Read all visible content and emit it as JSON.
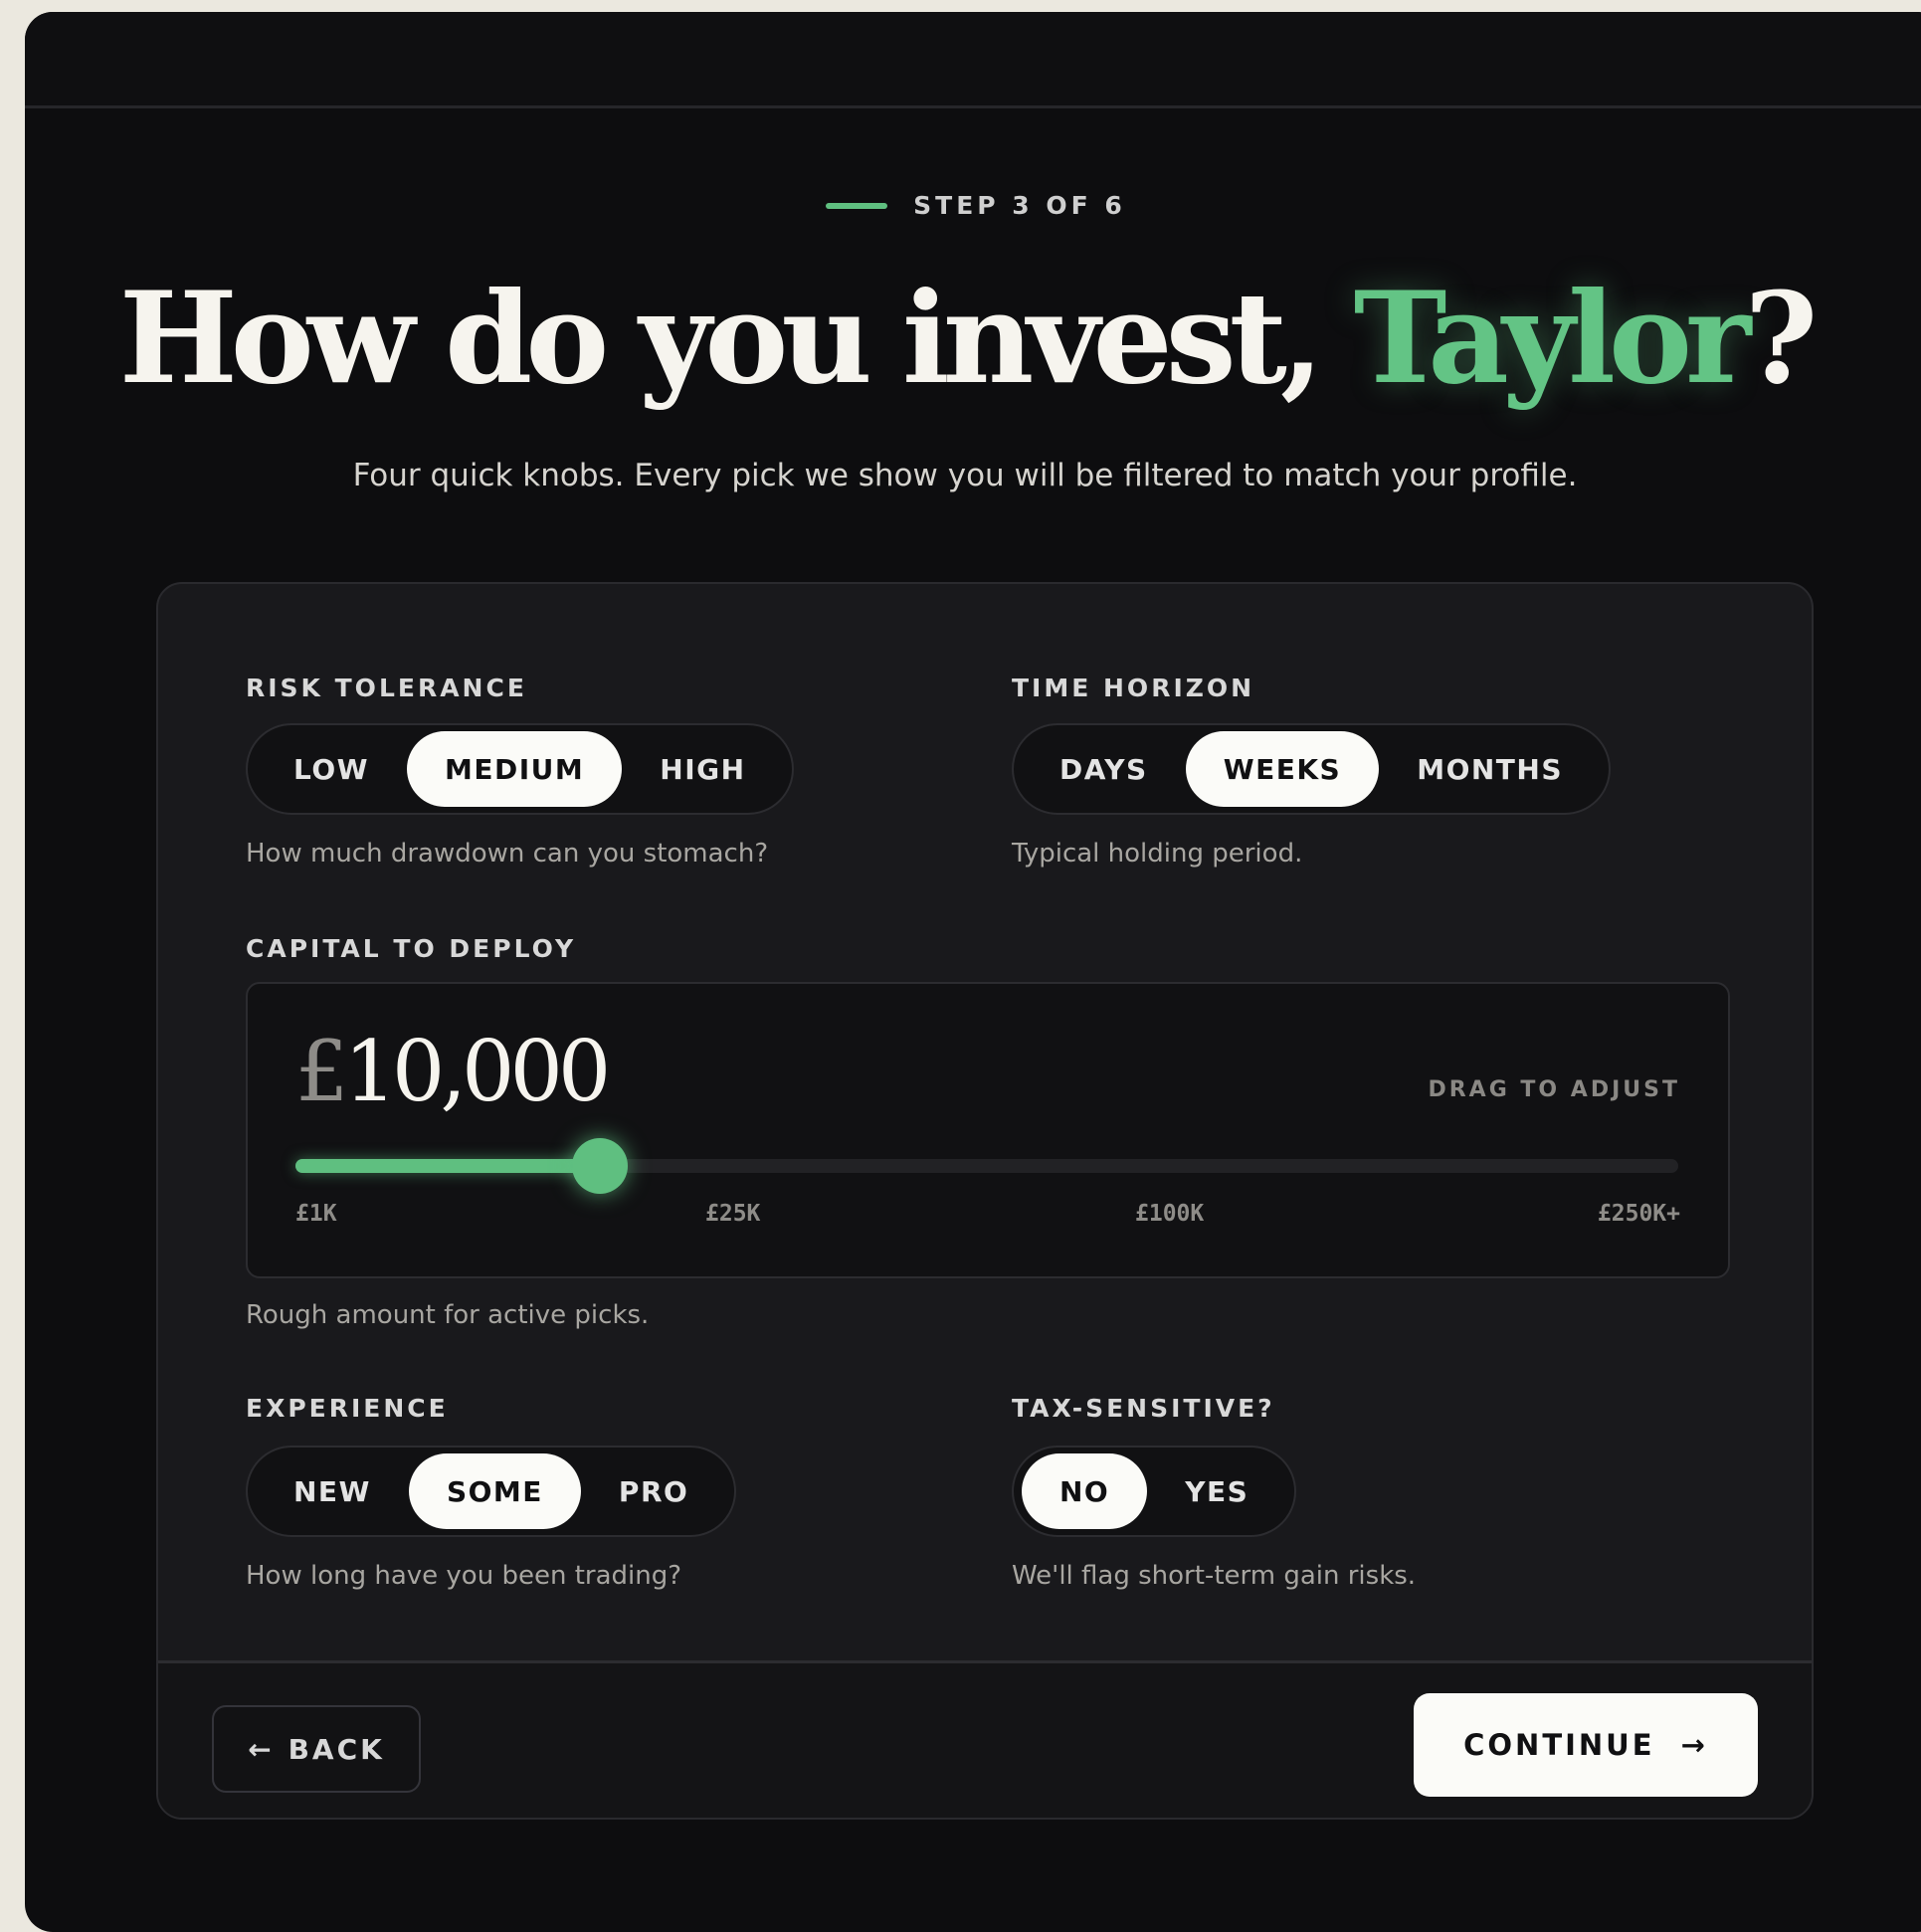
{
  "step": {
    "label": "STEP 3 OF 6"
  },
  "headline": {
    "prefix": "How do you invest, ",
    "name": "Taylor",
    "suffix": "?"
  },
  "subtitle": "Four quick knobs. Every pick we show you will be filtered to match your profile.",
  "risk_tolerance": {
    "label": "RISK TOLERANCE",
    "options": [
      "LOW",
      "MEDIUM",
      "HIGH"
    ],
    "selected": "MEDIUM",
    "help": "How much drawdown can you stomach?"
  },
  "time_horizon": {
    "label": "TIME HORIZON",
    "options": [
      "DAYS",
      "WEEKS",
      "MONTHS"
    ],
    "selected": "WEEKS",
    "help": "Typical holding period."
  },
  "capital": {
    "label": "CAPITAL TO DEPLOY",
    "currency": "£",
    "amount": "10,000",
    "drag_hint": "DRAG TO ADJUST",
    "slider_fraction": 0.22,
    "ticks": [
      "£1K",
      "£25K",
      "£100K",
      "£250K+"
    ],
    "help": "Rough amount for active picks."
  },
  "experience": {
    "label": "EXPERIENCE",
    "options": [
      "NEW",
      "SOME",
      "PRO"
    ],
    "selected": "SOME",
    "help": "How long have you been trading?"
  },
  "tax_sensitive": {
    "label": "TAX-SENSITIVE?",
    "options": [
      "NO",
      "YES"
    ],
    "selected": "NO",
    "help": "We'll flag short-term gain risks."
  },
  "footer": {
    "back_label": "BACK",
    "back_icon": "arrow-left-icon",
    "continue_label": "CONTINUE",
    "continue_icon": "arrow-right-icon"
  },
  "colors": {
    "accent": "#5fbf80",
    "background": "#0d0d0f",
    "card": "#19191c",
    "active_pill": "#fbfbf8"
  }
}
